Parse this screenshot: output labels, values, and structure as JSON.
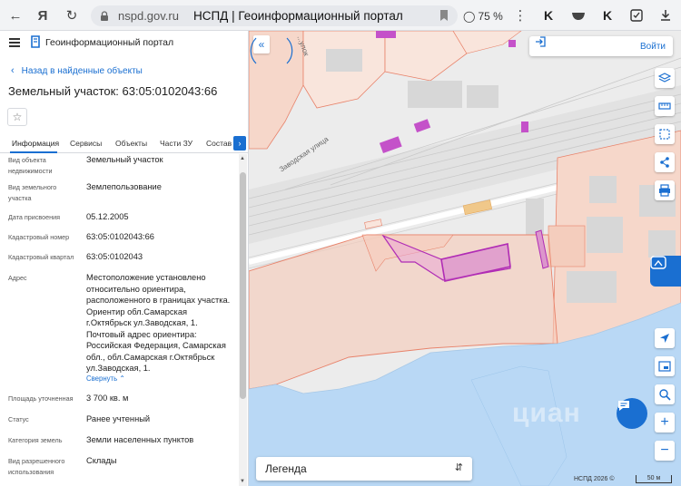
{
  "browser": {
    "domain": "nspd.gov.ru",
    "page_title": "НСПД | Геоинформационный портал",
    "zoom": "75 %"
  },
  "panel": {
    "portal_name": "Геоинформационный портал",
    "back_link": "Назад в найденные объекты",
    "object_title": "Земельный участок: 63:05:0102043:66",
    "tabs": [
      {
        "label": "Информация"
      },
      {
        "label": "Сервисы"
      },
      {
        "label": "Объекты"
      },
      {
        "label": "Части ЗУ"
      },
      {
        "label": "Состав"
      }
    ],
    "props": [
      {
        "label": "Вид объекта недвижимости",
        "value": "Земельный участок"
      },
      {
        "label": "Вид земельного участка",
        "value": "Землепользование"
      },
      {
        "label": "Дата присвоения",
        "value": "05.12.2005"
      },
      {
        "label": "Кадастровый номер",
        "value": "63:05:0102043:66"
      },
      {
        "label": "Кадастровый квартал",
        "value": "63:05:0102043"
      },
      {
        "label": "Адрес",
        "value": "Местоположение установлено относительно ориентира, расположенного в границах участка. Ориентир обл.Самарская г.Октябрьск ул.Заводская, 1. Почтовый адрес ориентира: Российская Федерация, Самарская обл., обл.Самарская г.Октябрьск ул.Заводская, 1."
      },
      {
        "label": "Площадь уточненная",
        "value": "3 700 кв. м"
      },
      {
        "label": "Статус",
        "value": "Ранее учтенный"
      },
      {
        "label": "Категория земель",
        "value": "Земли населенных пунктов"
      },
      {
        "label": "Вид разрешенного использования",
        "value": "Склады"
      }
    ],
    "collapse_label": "Свернуть"
  },
  "map": {
    "login_label": "Войти",
    "legend_label": "Легенда",
    "copyright": "НСПД 2026 ©",
    "scale_label": "50 м",
    "street_label_1": "Заводская улица",
    "street_label_2": "...улок",
    "watermark": "циан"
  },
  "colors": {
    "accent": "#1a6fd1",
    "parcel_fill": "#f7c9b8",
    "parcel_stroke": "#e8826a",
    "selected_stroke": "#b02cb5",
    "water": "#b9d8f5"
  }
}
